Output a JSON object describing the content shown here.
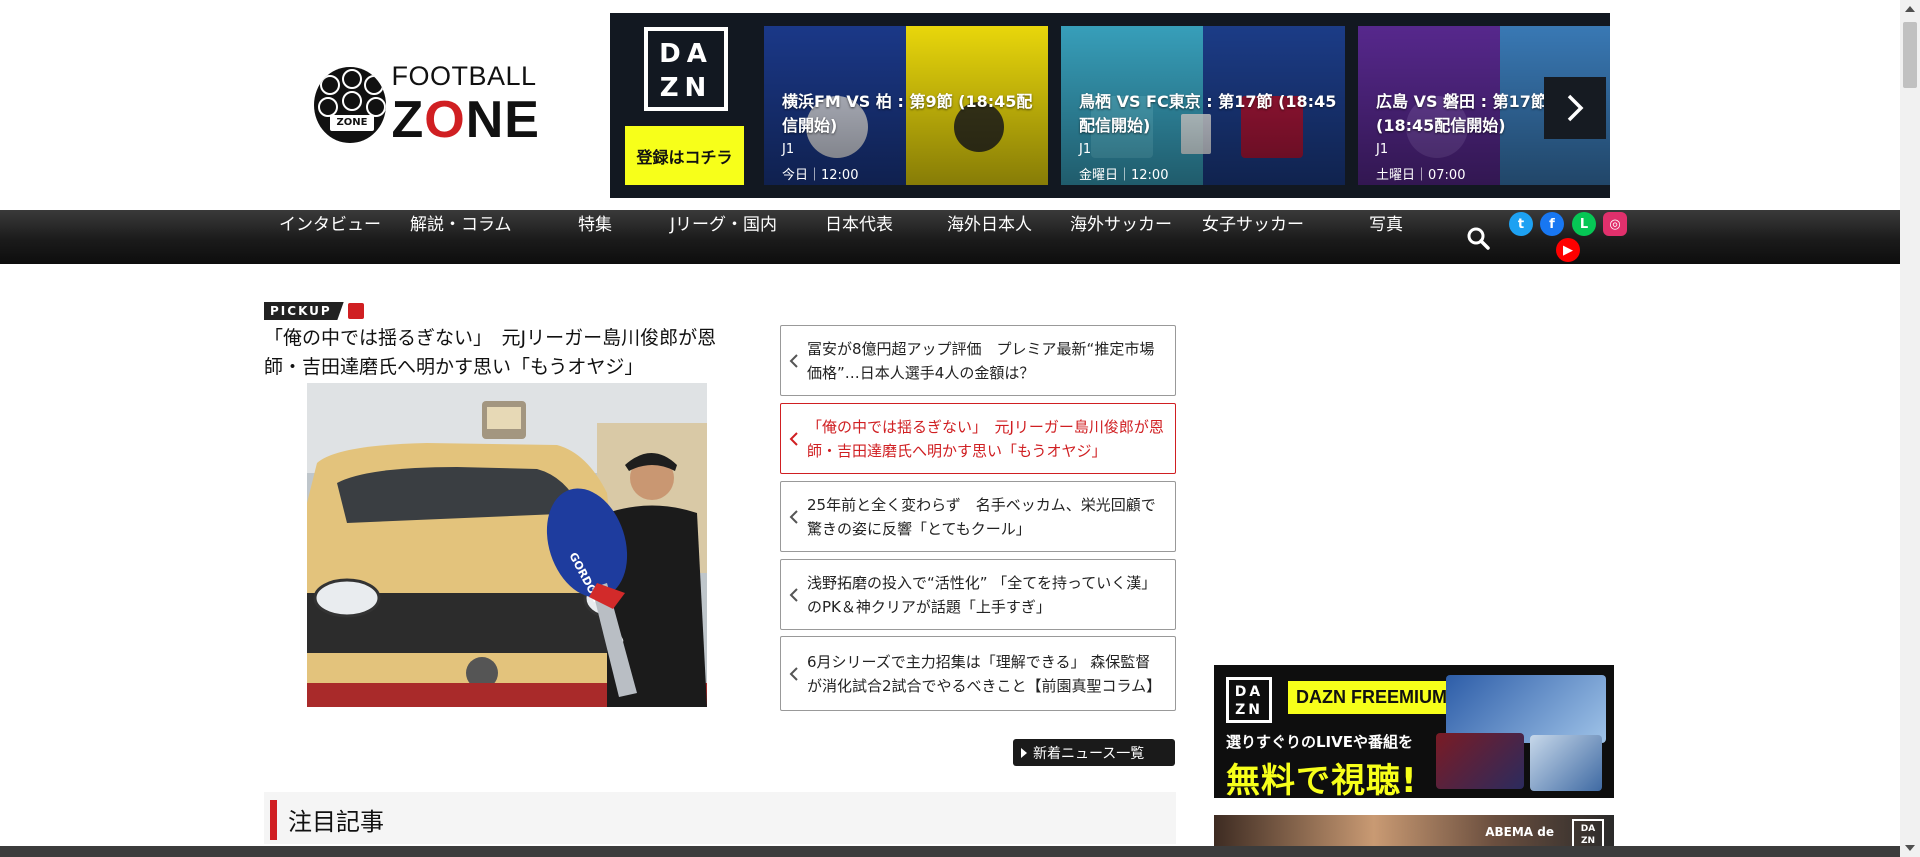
{
  "header": {
    "logo": {
      "line1": "FOOTBALL",
      "line2_a": "Z",
      "line2_o": "O",
      "line2_b": "NE",
      "ball_text": "ZONE"
    },
    "dazn": {
      "logo_text": "DA ZN",
      "register_label": "登録はコチラ",
      "matches": [
        {
          "title": "横浜FM VS 柏 : 第9節 (18:45配信開始)",
          "league": "J1",
          "time": "今日｜12:00",
          "color_left": "#1c3b8f",
          "color_right": "#f5e20c"
        },
        {
          "title": "鳥栖 VS FC東京 : 第17節 (18:45配信開始)",
          "league": "J1",
          "time": "金曜日｜12:00",
          "color_left": "#3aa7c4",
          "color_right": "#1d3f8e"
        },
        {
          "title": "広島 VS 磐田 : 第17節 (18:45配信開始)",
          "league": "J1",
          "time": "土曜日｜07:00",
          "color_left": "#5b2a94",
          "color_right": "#3c7fbe"
        }
      ],
      "next_icon": "chevron-right-icon"
    }
  },
  "nav": {
    "items": [
      "インタビュー",
      "解説・コラム",
      "特集",
      "Jリーグ・国内",
      "日本代表",
      "海外日本人",
      "海外サッカー",
      "女子サッカー",
      "写真"
    ],
    "search_icon": "search-icon",
    "sns": [
      {
        "name": "twitter-icon",
        "glyph": "t",
        "color": "#1da1f2"
      },
      {
        "name": "facebook-icon",
        "glyph": "f",
        "color": "#1877f2"
      },
      {
        "name": "line-icon",
        "glyph": "L",
        "color": "#06c755"
      },
      {
        "name": "instagram-icon",
        "glyph": "◎",
        "color": "#e1306c"
      },
      {
        "name": "youtube-icon",
        "glyph": "▶",
        "color": "#ff0000"
      }
    ]
  },
  "pickup": {
    "label": "PICKUP",
    "title": "「俺の中では揺るぎない」　元Jリーガー島川俊郎が恩師・吉田達磨氏へ明かす思い「もうオヤジ」",
    "image_alt": "man holding a large GORDON MILLER key in front of a yellow van",
    "key_text": "GORDON MILLER"
  },
  "news": [
    {
      "title": "冨安が8億円超アップ評価　プレミア最新“推定市場価格”…日本人選手4人の金額は？",
      "active": false
    },
    {
      "title": "「俺の中では揺るぎない」　元Jリーガー島川俊郎が恩師・吉田達磨氏へ明かす思い「もうオヤジ」",
      "active": true
    },
    {
      "title": "25年前と全く変わらず　名手ベッカム、栄光回顧で驚きの姿に反響「とてもクール」",
      "active": false
    },
    {
      "title": "浅野拓磨の投入で“活性化” 「全てを持っていく漢」のPK＆神クリアが話題「上手すぎ」",
      "active": false
    },
    {
      "title": "6月シリーズで主力招集は「理解できる」 森保監督が消化試合2試合でやるべきこと【前園真聖コラム】",
      "active": false
    }
  ],
  "more_news_label": "新着ニュース一覧",
  "featured_heading": "注目記事",
  "ads": {
    "dazn_freemium": {
      "logo": "DA ZN",
      "badge": "DAZN FREEMIUM",
      "sub": "選りすぐりのLIVEや番組を",
      "big": "無料で視聴!"
    },
    "abema": {
      "text": "ABEMA de",
      "logo": "DA ZN"
    }
  },
  "colors": {
    "accent": "#d01f22",
    "dazn_yellow": "#f7ff1a",
    "nav_dark": "#1b1b1b"
  }
}
